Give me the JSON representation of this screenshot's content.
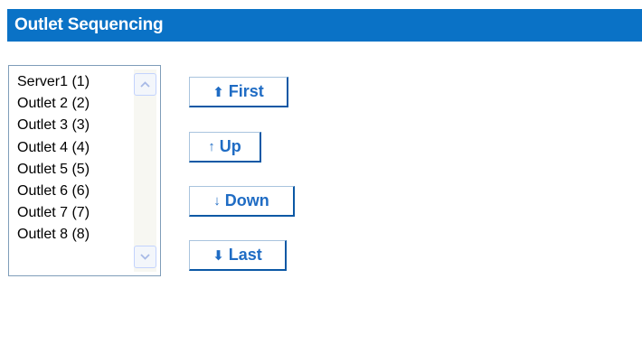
{
  "header": {
    "title": "Outlet Sequencing"
  },
  "outlet_list": {
    "items": [
      "Server1 (1)",
      "Outlet 2 (2)",
      "Outlet 3 (3)",
      "Outlet 4 (4)",
      "Outlet 5 (5)",
      "Outlet 6 (6)",
      "Outlet 7 (7)",
      "Outlet 8 (8)"
    ]
  },
  "buttons": {
    "first": {
      "icon": "⬆",
      "icon_name": "heavy-up-arrow-icon",
      "label": "First"
    },
    "up": {
      "icon": "↑",
      "icon_name": "up-arrow-icon",
      "label": "Up"
    },
    "down": {
      "icon": "↓",
      "icon_name": "down-arrow-icon",
      "label": "Down"
    },
    "last": {
      "icon": "⬇",
      "icon_name": "heavy-down-arrow-icon",
      "label": "Last"
    }
  },
  "colors": {
    "header_bg": "#0a72c6",
    "button_text": "#1f6cc4",
    "button_border": "#0b58a5"
  }
}
